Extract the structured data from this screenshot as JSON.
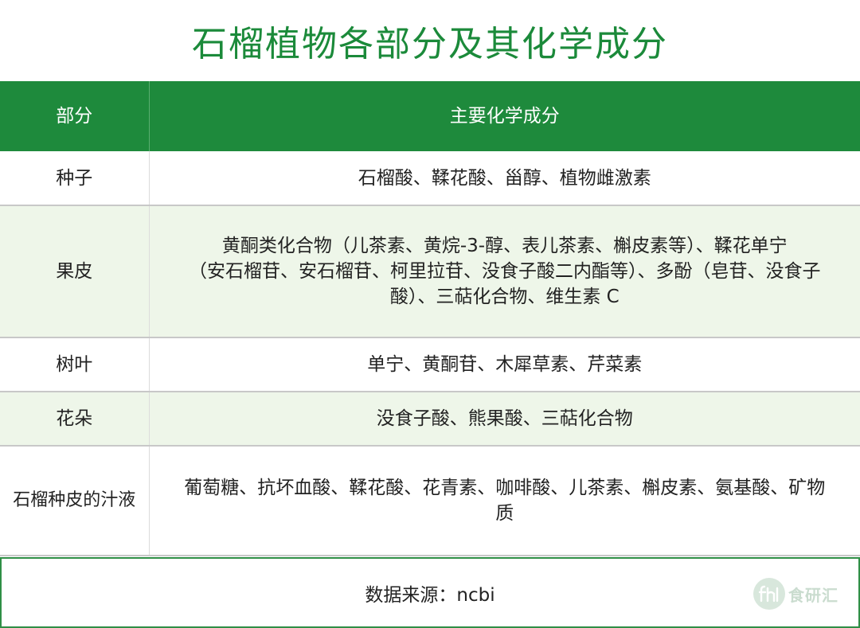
{
  "title": "石榴植物各部分及其化学成分",
  "table": {
    "headers": [
      "部分",
      "主要化学成分"
    ],
    "rows": [
      {
        "part": "种子",
        "components": "石榴酸、鞣花酸、甾醇、植物雌激素"
      },
      {
        "part": "果皮",
        "components_lines": [
          "黄酮类化合物（儿茶素、黄烷-3-醇、表儿茶素、槲皮素等）、鞣花单宁",
          "（安石榴苷、安石榴苷、柯里拉苷、没食子酸二内酯等）、多酚（皂苷、没食子",
          "酸）、三萜化合物、维生素 C"
        ]
      },
      {
        "part": "树叶",
        "components": "单宁、黄酮苷、木犀草素、芹菜素"
      },
      {
        "part": "花朵",
        "components": "没食子酸、熊果酸、三萜化合物"
      },
      {
        "part": "石榴种皮的汁液",
        "components_lines": [
          "葡萄糖、抗坏血酸、鞣花酸、花青素、咖啡酸、儿茶素、槲皮素、氨基酸、矿物",
          "质"
        ]
      }
    ]
  },
  "source": "数据来源：ncbi",
  "watermark": {
    "logo_icon": "fyh-logo-icon",
    "text": "食研汇"
  },
  "colors": {
    "accent": "#1e8a3c",
    "row_tint": "#eef6e9",
    "title": "#1b8a3a"
  }
}
